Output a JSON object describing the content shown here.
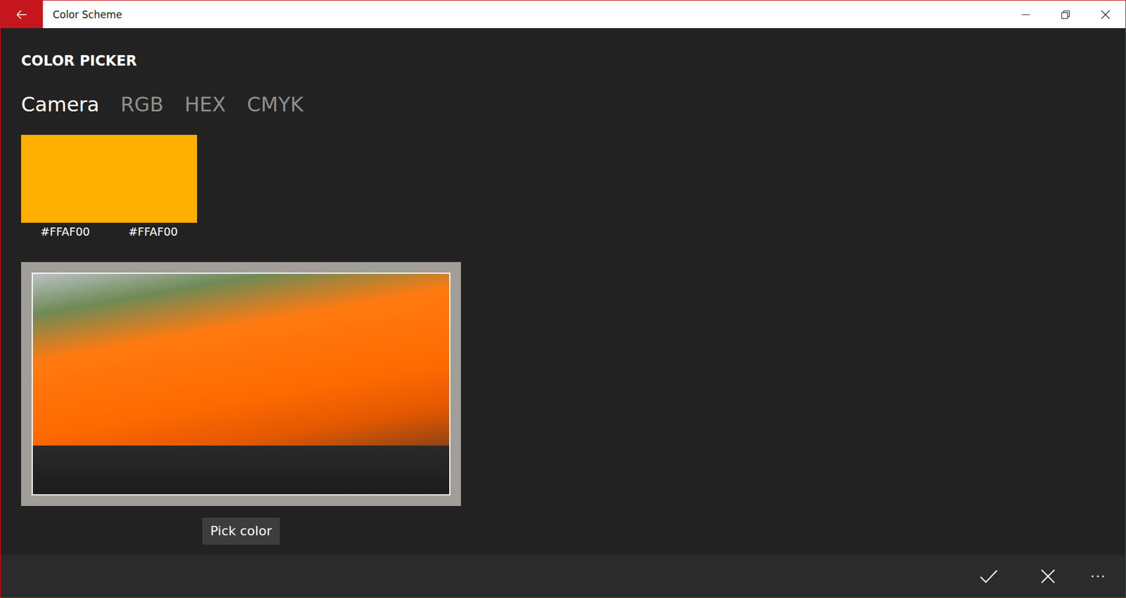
{
  "window": {
    "title": "Color Scheme"
  },
  "heading": "COLOR PICKER",
  "tabs": [
    {
      "label": "Camera",
      "selected": true
    },
    {
      "label": "RGB",
      "selected": false
    },
    {
      "label": "HEX",
      "selected": false
    },
    {
      "label": "CMYK",
      "selected": false
    }
  ],
  "swatches": [
    {
      "hex": "#FFAF00",
      "color": "#FFAF00"
    },
    {
      "hex": "#FFAF00",
      "color": "#FFAF00"
    }
  ],
  "pick_button": "Pick color"
}
